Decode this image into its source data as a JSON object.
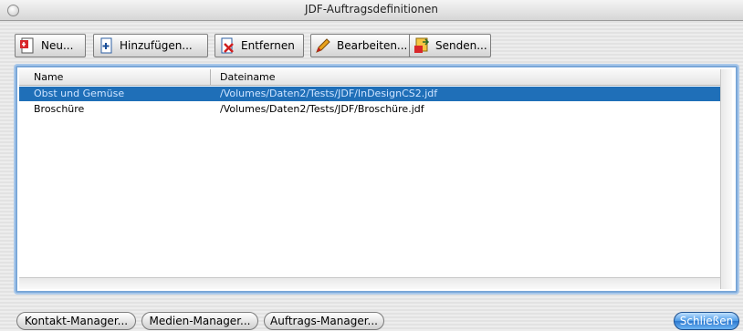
{
  "window": {
    "title": "JDF-Auftragsdefinitionen"
  },
  "toolbar": {
    "new_label": "Neu...",
    "add_label": "Hinzufügen...",
    "remove_label": "Entfernen",
    "edit_label": "Bearbeiten...",
    "send_label": "Senden..."
  },
  "list": {
    "columns": [
      "Name",
      "Dateiname"
    ],
    "rows": [
      {
        "name": "Obst und Gemüse",
        "file": "/Volumes/Daten2/Tests/JDF/InDesignCS2.jdf",
        "selected": true
      },
      {
        "name": "Broschüre",
        "file": "/Volumes/Daten2/Tests/JDF/Broschüre.jdf",
        "selected": false
      }
    ]
  },
  "footer": {
    "contact_label": "Kontakt-Manager...",
    "media_label": "Medien-Manager...",
    "jobs_label": "Auftrags-Manager...",
    "close_label": "Schließen"
  },
  "colors": {
    "selection": "#1f6fb8",
    "accent_button": "#4d9be6"
  }
}
